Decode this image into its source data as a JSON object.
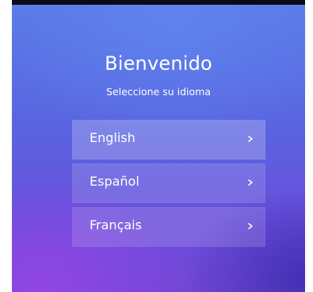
{
  "welcome": {
    "title": "Bienvenido",
    "subtitle": "Seleccione su idioma"
  },
  "languages": [
    {
      "label": "English",
      "icon": "chevron-right-icon"
    },
    {
      "label": "Español",
      "icon": "chevron-right-icon"
    },
    {
      "label": "Français",
      "icon": "chevron-right-icon"
    }
  ],
  "colors": {
    "background_top": "#5a7ae6",
    "background_bottom": "#7446d6",
    "text": "#ffffff"
  }
}
